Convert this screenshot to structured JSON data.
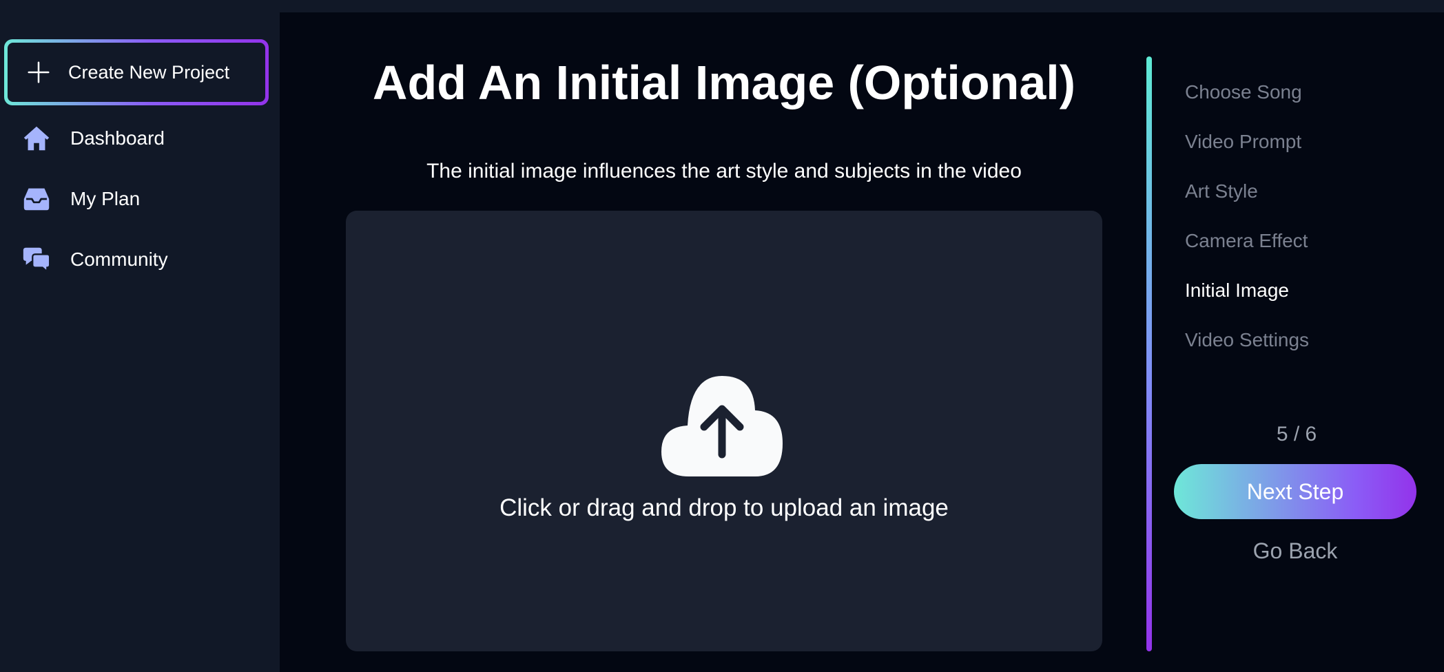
{
  "sidebar": {
    "create_button": {
      "label": "Create New Project",
      "icon": "plus-icon"
    },
    "items": [
      {
        "label": "Dashboard",
        "icon": "home-icon"
      },
      {
        "label": "My Plan",
        "icon": "inbox-icon"
      },
      {
        "label": "Community",
        "icon": "chat-bubbles-icon"
      }
    ]
  },
  "main": {
    "title": "Add An Initial Image (Optional)",
    "subtitle": "The initial image influences the art style and subjects in the video",
    "upload": {
      "icon": "cloud-upload-icon",
      "label": "Click or drag and drop to upload an image"
    }
  },
  "steps": {
    "items": [
      {
        "label": "Choose Song",
        "active": false
      },
      {
        "label": "Video Prompt",
        "active": false
      },
      {
        "label": "Art Style",
        "active": false
      },
      {
        "label": "Camera Effect",
        "active": false
      },
      {
        "label": "Initial Image",
        "active": true
      },
      {
        "label": "Video Settings",
        "active": false
      }
    ],
    "counter": "5 / 6",
    "next_label": "Next Step",
    "back_label": "Go Back"
  },
  "colors": {
    "accent_start": "#6ee7d8",
    "accent_end": "#9333ea",
    "nav_icon": "#a5b4fc",
    "sidebar_bg": "#111827",
    "main_bg": "#030712",
    "dropzone_bg": "#1b2130",
    "muted_text": "#7b8190"
  }
}
